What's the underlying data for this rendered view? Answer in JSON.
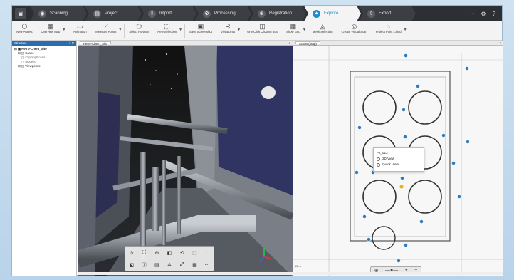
{
  "tabs": [
    {
      "label": "Scanning",
      "icon": "scanning-icon"
    },
    {
      "label": "Project",
      "icon": "project-icon"
    },
    {
      "label": "Import",
      "icon": "import-icon"
    },
    {
      "label": "Processing",
      "icon": "processing-icon"
    },
    {
      "label": "Registration",
      "icon": "registration-icon"
    },
    {
      "label": "Explore",
      "icon": "explore-icon",
      "active": true
    },
    {
      "label": "Export",
      "icon": "export-icon"
    }
  ],
  "ribbon": [
    {
      "label": "New Project",
      "icon": "cube-icon"
    },
    {
      "label": "Overview Map",
      "icon": "map-icon"
    },
    {
      "label": "Animation",
      "icon": "film-icon"
    },
    {
      "label": "Measure Points",
      "icon": "measure-icon"
    },
    {
      "label": "Select Polygon",
      "icon": "polygon-icon"
    },
    {
      "label": "New Selection",
      "icon": "selection-icon"
    },
    {
      "label": "Save Screenshot",
      "icon": "camera-icon"
    },
    {
      "label": "Viewpoints",
      "icon": "viewpoint-icon"
    },
    {
      "label": "One Click Clipping Box",
      "icon": "clipping-box-icon"
    },
    {
      "label": "Show Grid",
      "icon": "grid-icon"
    },
    {
      "label": "Mesh Selection",
      "icon": "mesh-icon"
    },
    {
      "label": "Create Virtual Scan",
      "icon": "virtual-scan-icon"
    },
    {
      "label": "Project Point Cloud",
      "icon": "point-cloud-icon"
    }
  ],
  "structure": {
    "title": "Structure",
    "root": "Petro-Chem_Site",
    "items": [
      "Scans",
      "ClippingBoxes",
      "Models",
      "Viewpoints"
    ]
  },
  "view3d": {
    "tab_label": "Petro-Chem_Site"
  },
  "view2d": {
    "tab_label": "Scans (Map)",
    "scale": "15 m"
  },
  "popup": {
    "title": "Pk_013",
    "option1": "3D View",
    "option2": "Quick View"
  },
  "colors": {
    "accent": "#1b8fd1",
    "marker": "#2e7cc0",
    "selected_marker": "#e4b419"
  }
}
